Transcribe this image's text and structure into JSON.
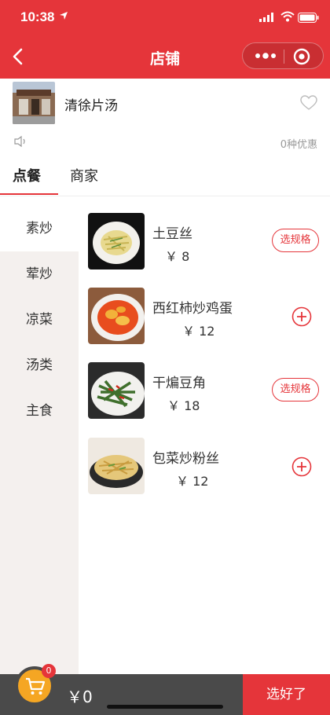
{
  "status_bar": {
    "time": "10:38"
  },
  "nav": {
    "title": "店铺"
  },
  "shop": {
    "name": "清徐片汤",
    "promo": "0种优惠"
  },
  "tabs": [
    {
      "label": "点餐"
    },
    {
      "label": "商家"
    }
  ],
  "categories": [
    {
      "label": "素炒"
    },
    {
      "label": "荤炒"
    },
    {
      "label": "凉菜"
    },
    {
      "label": "汤类"
    },
    {
      "label": "主食"
    }
  ],
  "dishes": [
    {
      "name": "土豆丝",
      "price": "￥ 8",
      "action": "选规格"
    },
    {
      "name": "西红柿炒鸡蛋",
      "price": "￥ 12",
      "action": "+"
    },
    {
      "name": "干煸豆角",
      "price": "￥ 18",
      "action": "选规格"
    },
    {
      "name": "包菜炒粉丝",
      "price": "￥ 12",
      "action": "+"
    }
  ],
  "cart": {
    "count": "0",
    "total": "￥0",
    "checkout_label": "选好了"
  },
  "colors": {
    "accent": "#e5353a",
    "cart": "#f5a623",
    "bottom_bar": "#4a4a4a"
  },
  "icons": [
    "location-arrow-icon",
    "signal-icon",
    "wifi-icon",
    "battery-icon",
    "back-arrow-icon",
    "more-dots-icon",
    "target-icon",
    "heart-icon",
    "speaker-icon",
    "plus-circle-icon",
    "cart-icon"
  ]
}
